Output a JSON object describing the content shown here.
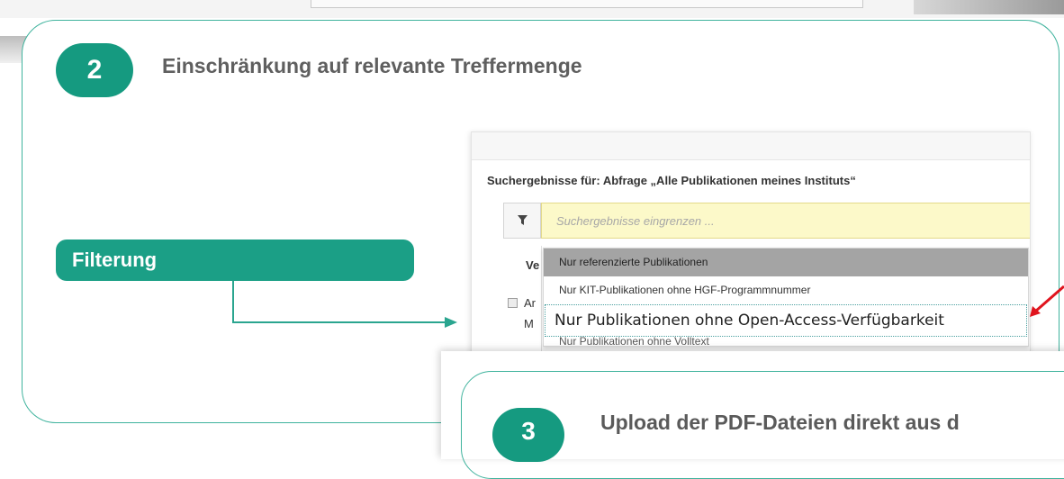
{
  "step2": {
    "number": "2",
    "title": "Einschränkung auf relevante Treffermenge",
    "filter_label": "Filterung"
  },
  "results": {
    "heading": "Suchergebnisse für: Abfrage „Alle Publikationen meines Instituts“",
    "filter_placeholder": "Suchergebnisse eingrenzen ...",
    "column_header_fragment": "Ve",
    "row_fragments": [
      "Ar",
      "M"
    ]
  },
  "dropdown": {
    "items": [
      "Nur referenzierte Publikationen",
      "Nur KIT-Publikationen ohne HGF-Programmnummer",
      "Nur Publikationen ohne Open-Access-Verfügbarkeit",
      "Nur Publikationen ohne Volltext"
    ],
    "hovered_index": 0,
    "focused_index": 2
  },
  "step3": {
    "number": "3",
    "title": "Upload der PDF-Dateien direkt aus d"
  },
  "colors": {
    "brand_green": "#159a80",
    "card_border": "#3fb39d",
    "input_highlight": "#fcf9c9",
    "pointer_red": "#e0141e"
  }
}
